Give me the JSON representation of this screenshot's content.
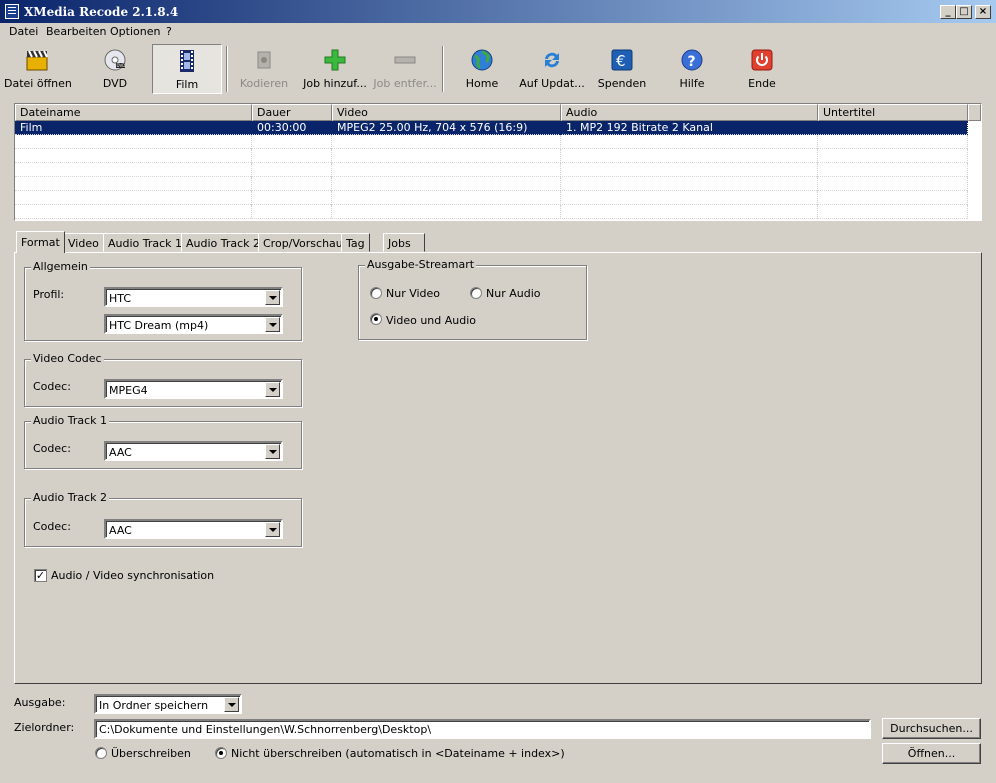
{
  "window": {
    "title": "XMedia Recode 2.1.8.4"
  },
  "menu": [
    "Datei",
    "Bearbeiten",
    "Optionen",
    "?"
  ],
  "toolbar": {
    "open_file": "Datei öffnen",
    "dvd": "DVD",
    "film": "Film",
    "encode": "Kodieren",
    "add_job": "Job hinzuf...",
    "remove_job": "Job entfer...",
    "home": "Home",
    "update": "Auf Updat...",
    "donate": "Spenden",
    "help": "Hilfe",
    "exit": "Ende"
  },
  "list": {
    "columns": [
      "Dateiname",
      "Dauer",
      "Video",
      "Audio",
      "Untertitel"
    ],
    "rows": [
      {
        "name": "Film",
        "duration": "00:30:00",
        "video": "MPEG2 25.00 Hz, 704 x 576 (16:9)",
        "audio": "1. MP2 192 Bitrate 2 Kanal",
        "subtitle": ""
      }
    ]
  },
  "tabs": [
    "Format",
    "Video",
    "Audio Track 1",
    "Audio Track 2",
    "Crop/Vorschau",
    "Tag",
    "Jobs"
  ],
  "format": {
    "general": {
      "title": "Allgemein",
      "profile_label": "Profil:",
      "profile_value": "HTC",
      "device_value": "HTC Dream (mp4)"
    },
    "video_codec": {
      "title": "Video Codec",
      "codec_label": "Codec:",
      "codec_value": "MPEG4"
    },
    "audio_track1": {
      "title": "Audio Track 1",
      "codec_label": "Codec:",
      "codec_value": "AAC"
    },
    "audio_track2": {
      "title": "Audio Track 2",
      "codec_label": "Codec:",
      "codec_value": "AAC"
    },
    "stream_type": {
      "title": "Ausgabe-Streamart",
      "video_only": "Nur Video",
      "audio_only": "Nur Audio",
      "video_audio": "Video und Audio",
      "selected": "video_audio"
    },
    "av_sync": {
      "label": "Audio / Video synchronisation",
      "checked": true
    }
  },
  "output": {
    "mode_label": "Ausgabe:",
    "mode_value": "In Ordner speichern",
    "folder_label": "Zielordner:",
    "folder_value": "C:\\Dokumente und Einstellungen\\W.Schnorrenberg\\Desktop\\",
    "browse": "Durchsuchen...",
    "open": "Öffnen...",
    "overwrite": "Überschreiben",
    "no_overwrite": "Nicht überschreiben (automatisch in <Dateiname + index>)",
    "overwrite_selected": "no_overwrite"
  }
}
